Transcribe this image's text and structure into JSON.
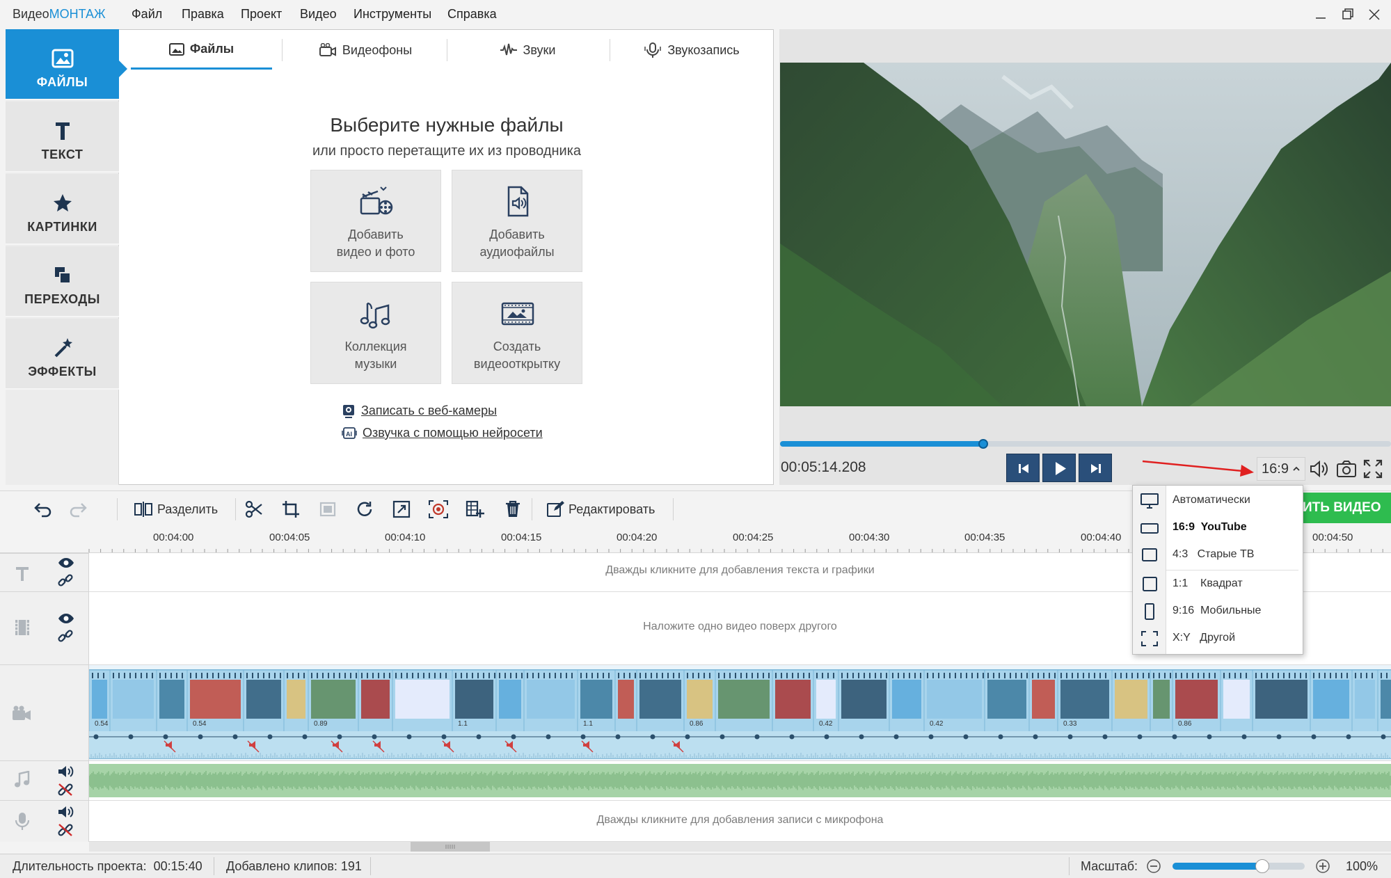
{
  "app": {
    "logo_part1": "Видео",
    "logo_part2": "МОНТАЖ"
  },
  "menu": [
    "Файл",
    "Правка",
    "Проект",
    "Видео",
    "Инструменты",
    "Справка"
  ],
  "sidebar": {
    "items": [
      {
        "label": "ФАЙЛЫ",
        "icon": "image-icon",
        "active": true
      },
      {
        "label": "ТЕКСТ",
        "icon": "text-icon"
      },
      {
        "label": "КАРТИНКИ",
        "icon": "star-icon"
      },
      {
        "label": "ПЕРЕХОДЫ",
        "icon": "transitions-icon"
      },
      {
        "label": "ЭФФЕКТЫ",
        "icon": "magic-wand-icon"
      }
    ]
  },
  "tabs": [
    {
      "label": "Файлы",
      "icon": "image-icon",
      "active": true
    },
    {
      "label": "Видеофоны",
      "icon": "film-icon"
    },
    {
      "label": "Звуки",
      "icon": "waveform-icon"
    },
    {
      "label": "Звукозапись",
      "icon": "microphone-icon"
    }
  ],
  "files_panel": {
    "title": "Выберите нужные файлы",
    "subtitle": "или просто перетащите их из проводника",
    "tiles": [
      {
        "line1": "Добавить",
        "line2": "видео и фото",
        "icon": "film-camera-icon"
      },
      {
        "line1": "Добавить",
        "line2": "аудиофайлы",
        "icon": "audio-file-icon"
      },
      {
        "line1": "Коллекция",
        "line2": "музыки",
        "icon": "music-notes-icon"
      },
      {
        "line1": "Создать",
        "line2": "видеооткрытку",
        "icon": "video-card-icon"
      }
    ],
    "links": [
      {
        "label": "Записать с веб-камеры",
        "icon": "webcam-icon"
      },
      {
        "label": "Озвучка с помощью нейросети",
        "icon": "ai-voice-icon"
      }
    ]
  },
  "player": {
    "timecode": "00:05:14.208",
    "progress": 0.333,
    "ratio_label": "16:9"
  },
  "toolbar": {
    "split_label": "Разделить",
    "edit_label": "Редактировать",
    "export_label": "ИТЬ ВИДЕО"
  },
  "timeline": {
    "ticks": [
      "00:04:00",
      "00:04:05",
      "00:04:10",
      "00:04:15",
      "00:04:20",
      "00:04:25",
      "00:04:30",
      "00:04:35",
      "00:04:40",
      "00:04:50"
    ],
    "text_track_hint": "Дважды кликните для добавления текста и графики",
    "overlay_track_hint": "Наложите одно видео поверх другого",
    "mic_track_hint": "Дважды кликните для добавления записи с микрофона",
    "clip_labels": [
      "0.54",
      "0.54",
      "0.89",
      "1.1",
      "1.1",
      "0.86",
      "0.42",
      "0.42",
      "0.33",
      "0.86"
    ]
  },
  "status": {
    "duration_label": "Длительность проекта:",
    "duration_value": "00:15:40",
    "clips_label": "Добавлено клипов:",
    "clips_value": "191",
    "zoom_label": "Масштаб:",
    "zoom_value": "100%",
    "zoom_level": 0.68
  },
  "ratio_menu": [
    {
      "code": "",
      "name": "Автоматически",
      "icon": "monitor-icon"
    },
    {
      "code": "16:9",
      "name": "YouTube",
      "icon": "wide-rect-icon",
      "selected": true
    },
    {
      "code": "4:3",
      "name": "Старые ТВ",
      "icon": "rect-icon"
    },
    {
      "code": "1:1",
      "name": "Квадрат",
      "icon": "square-icon"
    },
    {
      "code": "9:16",
      "name": "Мобильные",
      "icon": "tall-rect-icon"
    },
    {
      "code": "X:Y",
      "name": "Другой",
      "icon": "custom-frame-icon"
    }
  ],
  "colors": {
    "accent": "#1a8fd6",
    "export": "#2ebc4f",
    "annotation_arrow": "#e02020"
  }
}
